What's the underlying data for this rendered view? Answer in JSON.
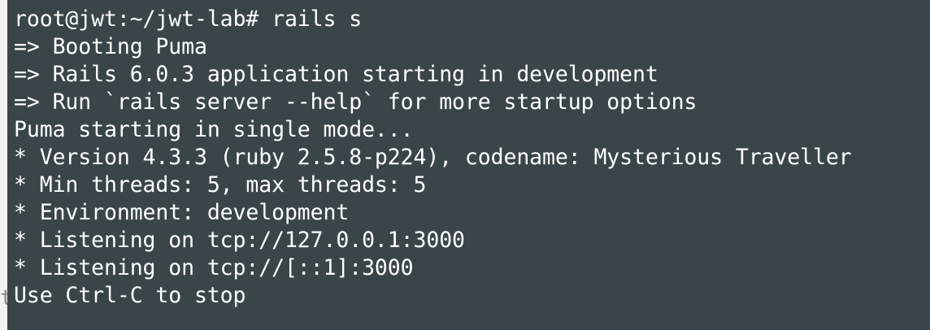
{
  "terminal": {
    "lines": [
      "root@jwt:~/jwt-lab# rails s",
      "=> Booting Puma",
      "=> Rails 6.0.3 application starting in development",
      "=> Run `rails server --help` for more startup options",
      "Puma starting in single mode...",
      "* Version 4.3.3 (ruby 2.5.8-p224), codename: Mysterious Traveller",
      "* Min threads: 5, max threads: 5",
      "* Environment: development",
      "* Listening on tcp://127.0.0.1:3000",
      "* Listening on tcp://[::1]:3000",
      "Use Ctrl-C to stop"
    ],
    "stray_char": "t"
  },
  "colors": {
    "terminal_bg": "#394549",
    "terminal_fg": "#ffffff",
    "page_bg": "#f2f2f2"
  }
}
